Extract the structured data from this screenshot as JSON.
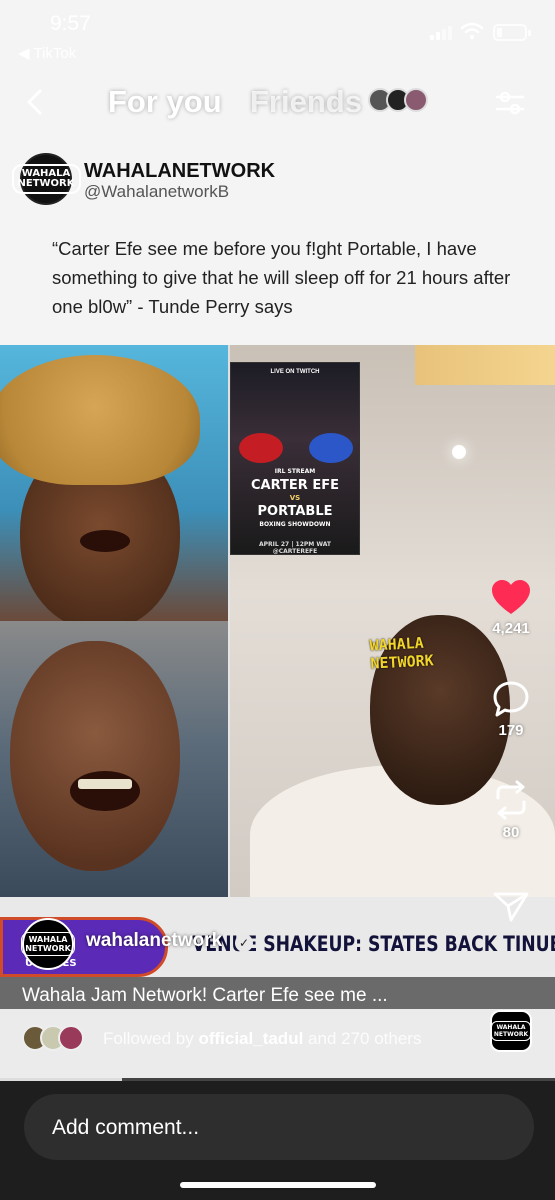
{
  "status_bar": {
    "time": "9:57",
    "back_app": "◀ TikTok"
  },
  "top_nav": {
    "tabs": [
      "For you",
      "Friends"
    ],
    "active_tab": "For you"
  },
  "tweet": {
    "account_name": "WAHALANETWORK",
    "handle": "@WahalanetworkB",
    "logo_text": "WAHALA NETWORK",
    "text": "“Carter Efe see me before you f!ght Portable, I have something to give that he will sleep off for 21 hours after one bl0w” - Tunde Perry says"
  },
  "poster": {
    "live": "LIVE ON TWITCH",
    "stream": "IRL STREAM",
    "fighter1": "CARTER EFE",
    "vs": "VS",
    "fighter2": "PORTABLE",
    "subtitle": "BOXING SHOWDOWN",
    "date": "APRIL 27 | 12PM WAT",
    "handle": "@CARTEREFE"
  },
  "video_watermark": "WAHALA\nNETWORK",
  "ticker": {
    "badge_top": "A",
    "badge_bottom": "UPDATES",
    "text": "VENUE SHAKEUP: STATES BACK TINUBU'S I"
  },
  "actions": {
    "likes": "4,241",
    "comments": "179",
    "reposts": "80",
    "liked_color": "#fe2c55"
  },
  "author": {
    "name": "wahalanetwork",
    "verified": true,
    "caption": "Wahala Jam Network! Carter Efe see me ..."
  },
  "followed": {
    "prefix": "Followed by",
    "user": "official_tadul",
    "suffix": "and 270 others"
  },
  "playback_progress": 0.22,
  "comment_box": {
    "placeholder": "Add comment..."
  }
}
